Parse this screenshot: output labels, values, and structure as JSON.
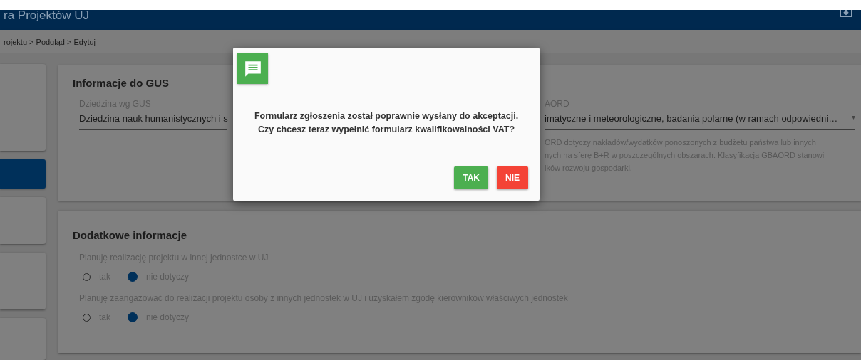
{
  "header": {
    "title": "ra Projektów UJ"
  },
  "breadcrumb": "rojektu > Podgląd > Edytuj",
  "sidebar": {
    "items": [
      {
        "selected": false
      },
      {
        "selected": true
      },
      {
        "selected": false
      },
      {
        "selected": false
      },
      {
        "selected": false
      }
    ]
  },
  "gus_card": {
    "title": "Informacje do GUS",
    "fields": [
      {
        "label": "Dziedzina wg GUS",
        "value": "Dziedzina nauk humanistycznych i s"
      },
      {
        "label": "AORD",
        "value": "imatyczne i meteorologiczne, badania polarne (w ramach odpowiedni…",
        "caret": "▾",
        "hint": [
          "ORD dotyczy nakładów/wydatków ponoszonych z budżetu państwa lub innych",
          "nych na sferę B+R w poszczególnych obszarach. Klasyfikacja GBAORD stanowi",
          "ików rozwoju gospodarki."
        ]
      }
    ]
  },
  "extra_card": {
    "title": "Dodatkowe informacje",
    "questions": [
      {
        "label": "Planuję realizację projektu w innej jednostce w UJ",
        "options": [
          {
            "label": "tak",
            "selected": false
          },
          {
            "label": "nie dotyczy",
            "selected": true
          }
        ]
      },
      {
        "label": "Planuję zaangażować do realizacji projektu osoby z innych jednostek w UJ i uzyskałem zgodę kierowników właściwych jednostek",
        "options": [
          {
            "label": "tak",
            "selected": false
          },
          {
            "label": "nie dotyczy",
            "selected": true
          }
        ]
      }
    ]
  },
  "dialog": {
    "message": [
      "Formularz zgłoszenia został poprawnie wysłany do akceptacji.",
      "Czy chcesz teraz wypełnić formularz kwalifikowalności VAT?"
    ],
    "buttons": [
      {
        "label": "TAK",
        "kind": "confirm"
      },
      {
        "label": "NIE",
        "kind": "cancel"
      }
    ]
  }
}
